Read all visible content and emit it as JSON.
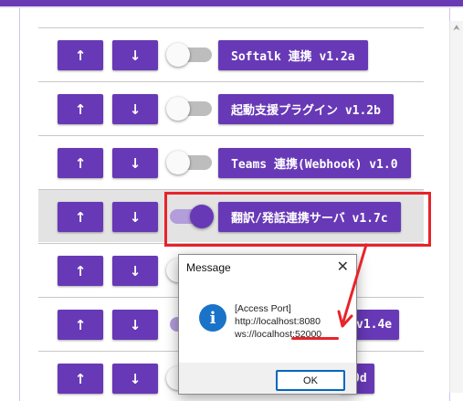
{
  "rows": [
    {
      "up": "↑",
      "down": "↓",
      "toggle_on": false,
      "label": "Softalk 連携 v1.2a"
    },
    {
      "up": "↑",
      "down": "↓",
      "toggle_on": false,
      "label": "起動支援プラグイン v1.2b"
    },
    {
      "up": "↑",
      "down": "↓",
      "toggle_on": false,
      "label": "Teams 連携(Webhook) v1.0"
    },
    {
      "up": "↑",
      "down": "↓",
      "toggle_on": true,
      "label": "翻訳/発話連携サーバ v1.7c"
    },
    {
      "up": "↑",
      "down": "↓",
      "toggle_on": false,
      "label": ""
    },
    {
      "up": "↑",
      "down": "↓",
      "toggle_on": true,
      "label": "v1.4e"
    },
    {
      "up": "↑",
      "down": "↓",
      "toggle_on": false,
      "label": "0d"
    }
  ],
  "dialog": {
    "title": "Message",
    "close": "✕",
    "icon": "info-icon",
    "lines": [
      "[Access Port]",
      "http://localhost:8080",
      "ws://localhost:52000"
    ],
    "ok": "OK"
  },
  "colors": {
    "accent": "#6739b6",
    "highlight": "#e8232a",
    "info": "#1a73c8"
  }
}
